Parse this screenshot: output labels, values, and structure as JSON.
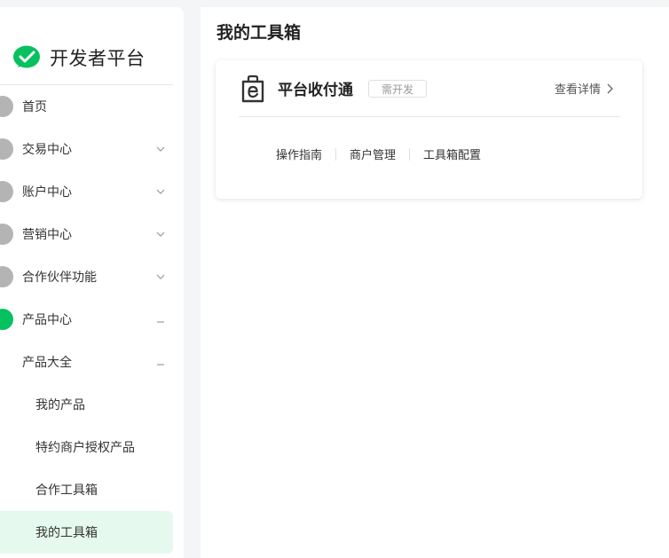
{
  "brand": {
    "name": "开发者平台",
    "logo_icon": "wechat-pay-check-logo",
    "accent": "#07c160"
  },
  "sidebar": {
    "items": [
      {
        "label": "首页",
        "icon": "home-dot",
        "expandable": false
      },
      {
        "label": "交易中心",
        "icon": "trade-dot",
        "expandable": true,
        "state": "collapsed"
      },
      {
        "label": "账户中心",
        "icon": "account-dot",
        "expandable": true,
        "state": "collapsed"
      },
      {
        "label": "营销中心",
        "icon": "marketing-dot",
        "expandable": true,
        "state": "collapsed"
      },
      {
        "label": "合作伙伴功能",
        "icon": "partner-dot",
        "expandable": true,
        "state": "collapsed"
      },
      {
        "label": "产品中心",
        "icon": "product-dot",
        "expandable": true,
        "state": "expanded"
      }
    ],
    "sub_items": [
      {
        "label": "产品大全",
        "state": "expanded"
      }
    ],
    "leaf_items": [
      {
        "label": "我的产品"
      },
      {
        "label": "特约商户授权产品"
      },
      {
        "label": "合作工具箱"
      },
      {
        "label": "我的工具箱",
        "active": true
      }
    ]
  },
  "main": {
    "title": "我的工具箱",
    "card": {
      "icon": "toolbox-e-icon",
      "title": "平台收付通",
      "badge": "需开发",
      "detail_link": "查看详情",
      "links": [
        "操作指南",
        "商户管理",
        "工具箱配置"
      ]
    }
  }
}
